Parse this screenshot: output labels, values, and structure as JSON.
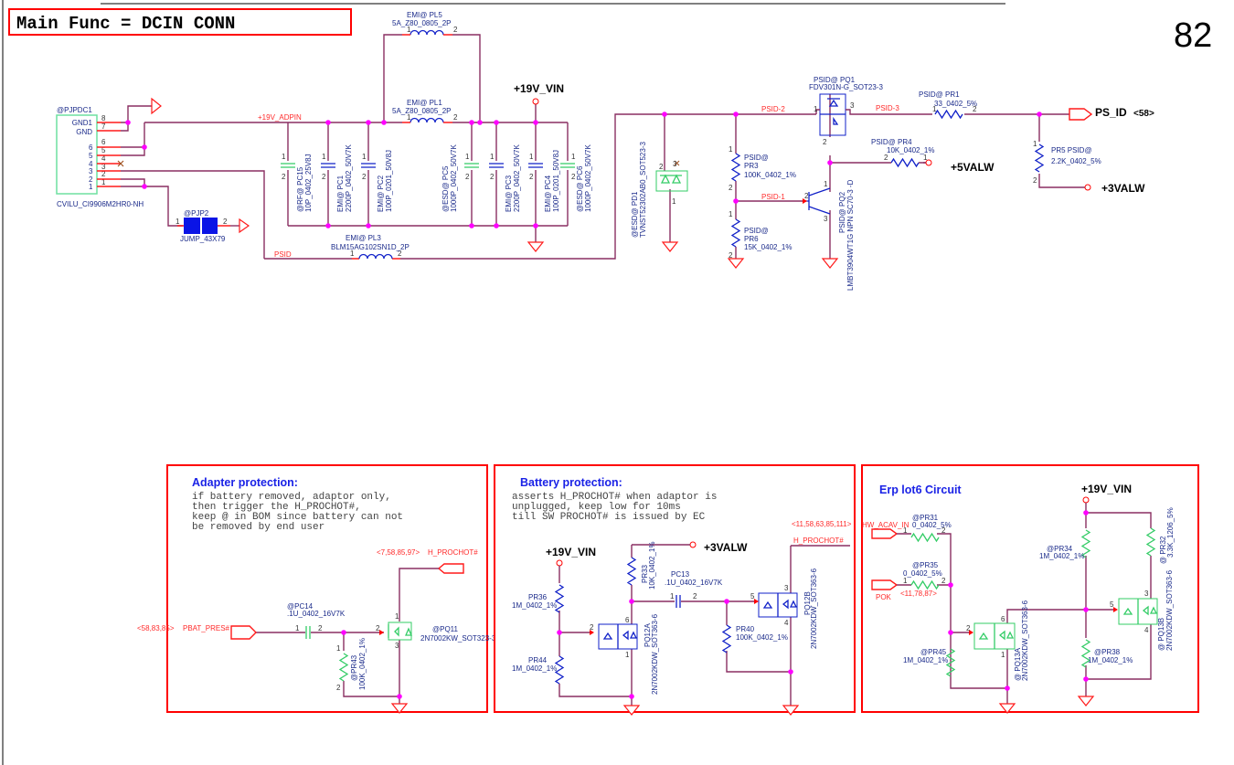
{
  "title": "Main Func = DCIN CONN",
  "page_number": "82",
  "pin": {
    "1": "1",
    "2": "2",
    "3": "3",
    "4": "4",
    "5": "5",
    "6": "6",
    "7": "7",
    "8": "8"
  },
  "colors": {
    "wire": "#8a2f62",
    "pin": "#ff1a1a",
    "part_blue": "#1020c8",
    "part_green": "#33cc66",
    "junction": "#ff00ff",
    "section_border": "#ff0000"
  },
  "connector": {
    "ref": "@PJPDC1",
    "part": "CVILU_CI9906M2HR0-NH",
    "gnd1": "GND1",
    "gnd": "GND"
  },
  "jumper": {
    "ref": "@PJP2",
    "part": "JUMP_43X79"
  },
  "nets": {
    "adpin": "+19V_ADPIN",
    "psid": "PSID",
    "psid1": "PSID-1",
    "psid2": "PSID-2",
    "psid3": "PSID-3",
    "vin": "+19V_VIN",
    "valw5": "+5VALW",
    "valw3": "+3VALW",
    "ps_id": "PS_ID",
    "ps_id_ref": "<58>"
  },
  "pl5": {
    "ref": "EMI@  PL5",
    "part": "5A_Z80_0805_2P"
  },
  "pl1": {
    "ref": "EMI@  PL1",
    "part": "5A_Z80_0805_2P"
  },
  "pl3": {
    "ref": "EMI@     PL3",
    "part": "BLM15AG102SN1D_2P"
  },
  "caps": [
    {
      "ref": "@RF@   PC15",
      "part": "10P_0402_25V8J"
    },
    {
      "ref": "EMI@  PC1",
      "part": "2200P_0402_50V7K"
    },
    {
      "ref": "EMI@  PC2",
      "part": "100P_0201_50V8J"
    },
    {
      "ref": "@ESD@  PC5",
      "part": "1000P_0402_50V7K"
    },
    {
      "ref": "EMI@  PC3",
      "part": "2200P_0402_50V7K"
    },
    {
      "ref": "EMI@  PC4",
      "part": "100P_0201_50V8J"
    },
    {
      "ref": "@ESD@  PC6",
      "part": "1000P_0402_50V7K"
    }
  ],
  "pd1": {
    "ref": "@ESD@  PD1",
    "part": "TVNST52302AB0_SOT523-3"
  },
  "pq1": {
    "ref": "PSID@    PQ1",
    "part": "FDV301N-G_SOT23-3"
  },
  "pq2": {
    "ref": "PSID@      PQ2",
    "part": "LMBT3904WT1G NPN SC70-3 -D"
  },
  "pr1": {
    "ref": "PSID@     PR1",
    "part": "33_0402_5%"
  },
  "pr3": {
    "tag": "PSID@",
    "ref": "PR3",
    "part": "100K_0402_1%"
  },
  "pr4": {
    "ref": "PSID@     PR4",
    "part": "10K_0402_1%"
  },
  "pr5": {
    "ref": "PR5  PSID@",
    "part": "2.2K_0402_5%"
  },
  "pr6": {
    "tag": "PSID@",
    "ref": "PR6",
    "part": "15K_0402_1%"
  },
  "adapter": {
    "title": "Adapter protection:",
    "note": [
      "if battery removed, adaptor only,",
      "then trigger the H_PROCHOT#,",
      "keep @ in BOM since battery can not",
      "be removed by end user"
    ],
    "prochot_ref": "<7,58,85,97>",
    "prochot": "H_PROCHOT#",
    "pbat_ref": "<58,83,85>",
    "pbat": "PBAT_PRES#",
    "pc14": {
      "ref": "@PC14",
      "part": ".1U_0402_16V7K"
    },
    "pr43": {
      "ref": "@PR43",
      "part": "100K_0402_1%"
    },
    "pq11": {
      "ref": "@PQ11",
      "part": "2N7002KW_SOT323-3"
    }
  },
  "battery": {
    "title": "Battery protection:",
    "note": [
      "asserts H_PROCHOT# when adaptor is",
      "unplugged, keep low for 10ms",
      "till SW PROCHOT# is issued by EC"
    ],
    "vin": "+19V_VIN",
    "valw3": "+3VALW",
    "prochot_ref": "<11,58,63,85,111>",
    "prochot": "H_PROCHOT#",
    "pr36": {
      "ref": "PR36",
      "part": "1M_0402_1%"
    },
    "pr44": {
      "ref": "PR44",
      "part": "1M_0402_1%"
    },
    "pr33": {
      "ref": "PR33",
      "part": "10K_0402_1%"
    },
    "pc13": {
      "ref": "PC13",
      "part": ".1U_0402_16V7K"
    },
    "pr40": {
      "ref": "PR40",
      "part": "100K_0402_1%"
    },
    "pq12a": {
      "ref": "PQ12A",
      "part": "2N7002KDW_SOT363-6"
    },
    "pq12b": {
      "ref": "PQ12B",
      "part": "2N7002KDW_SOT363-6"
    }
  },
  "erp": {
    "title": "Erp lot6 Circuit",
    "vin": "+19V_VIN",
    "acav": "HW_ACAV_IN",
    "pok": "POK",
    "pok_ref": "<11,78,87>",
    "pr31": {
      "ref": "@PR31",
      "part": "0_0402_5%"
    },
    "pr35": {
      "ref": "@PR35",
      "part": "0_0402_5%"
    },
    "pr45": {
      "ref": "@PR45",
      "part": "1M_0402_1%"
    },
    "pr34": {
      "ref": "@PR34",
      "part": "1M_0402_1%"
    },
    "pr38": {
      "ref": "@PR38",
      "part": "1M_0402_1%"
    },
    "pr32": {
      "ref": "@  PR32",
      "part": "3.3K_1206_5%"
    },
    "pq13a": {
      "ref": "@  PQ13A",
      "part": "2N7002KDW_SOT363-6"
    },
    "pq13b": {
      "ref": "@  PQ13B",
      "part": "2N7002KDW_SOT363-6"
    }
  }
}
